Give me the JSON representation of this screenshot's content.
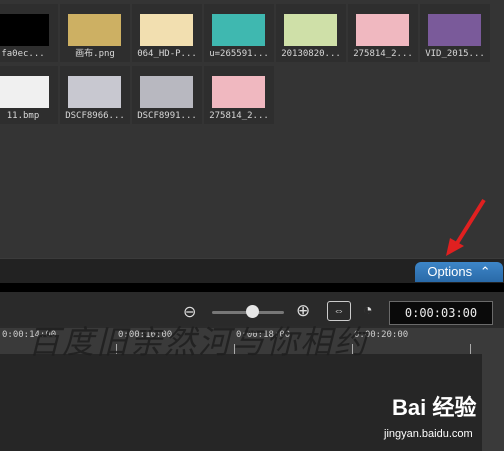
{
  "media_bin": {
    "row1": [
      {
        "label": "fa0ec...",
        "color": "#000000"
      },
      {
        "label": "画布.png",
        "color": "#cdb063"
      },
      {
        "label": "064_HD-P...",
        "color": "#f2dfb0"
      },
      {
        "label": "u=265591...",
        "color": "#3fb8b0"
      },
      {
        "label": "20130820...",
        "color": "#cfe0a8"
      },
      {
        "label": "275814_2...",
        "color": "#f0b8c0"
      },
      {
        "label": "VID_2015...",
        "color": "#7a5a9a"
      }
    ],
    "row2": [
      {
        "label": "11.bmp",
        "color": "#f0f0f0"
      },
      {
        "label": "DSCF8966...",
        "color": "#c8c8d0"
      },
      {
        "label": "DSCF8991...",
        "color": "#b8b8c0"
      },
      {
        "label": "275814_2...",
        "color": "#f0b8c0"
      }
    ]
  },
  "options_button": {
    "label": "Options"
  },
  "timeline": {
    "timecode": "0:00:03:00",
    "ruler_ticks": [
      "0:00:14:00",
      "0:00:16:00",
      "0:00:18:00",
      "0:00:20:00"
    ],
    "zoom_level": 0.55
  },
  "watermark": {
    "text": "百度旧亲然河与你相约",
    "brand": "Bai 经验",
    "brand_sub": "jingyan.baidu.com"
  }
}
